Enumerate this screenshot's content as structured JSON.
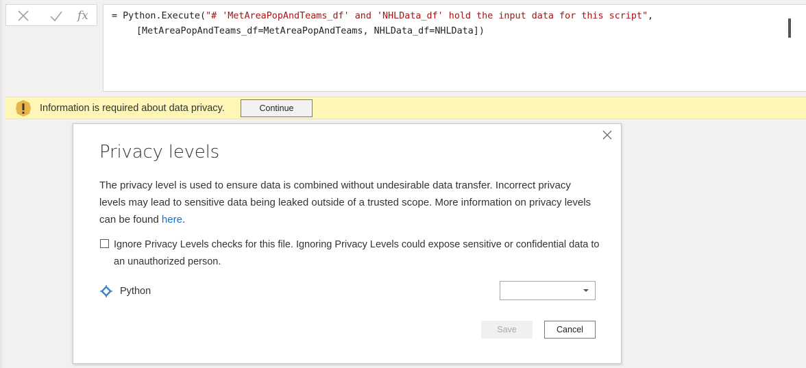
{
  "formula_bar": {
    "fx_label": "fx",
    "formula_line1_prefix": "= Python.Execute(",
    "formula_line1_string": "\"# 'MetAreaPopAndTeams_df' and 'NHLData_df' hold the input data for this script\"",
    "formula_line1_suffix": ",",
    "formula_line2": "[MetAreaPopAndTeams_df=MetAreaPopAndTeams, NHLData_df=NHLData])"
  },
  "info_bar": {
    "message": "Information is required about data privacy.",
    "continue_label": "Continue",
    "warning_color": "#e8b54a"
  },
  "dialog": {
    "title": "Privacy levels",
    "description": "The privacy level is used to ensure data is combined without undesirable data transfer. Incorrect privacy levels may lead to sensitive data being leaked outside of a trusted scope. More information on privacy levels can be found ",
    "link_text": "here",
    "description_end": ".",
    "ignore_checkbox_checked": false,
    "ignore_checkbox_label": "Ignore Privacy Levels checks for this file. Ignoring Privacy Levels could expose sensitive or confidential data to an unauthorized person.",
    "source_icon": "data-source-icon",
    "source_label": "Python",
    "privacy_level_value": "",
    "save_label": "Save",
    "cancel_label": "Cancel",
    "link_color": "#1a6fc4"
  }
}
